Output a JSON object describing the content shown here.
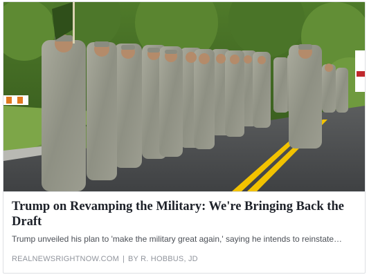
{
  "link_preview": {
    "headline": "Trump on Revamping the Military: We're Bringing Back the Draft",
    "description": "Trump unveiled his plan to 'make the military great again,' saying he intends to reinstate…",
    "source": "REALNEWSRIGHTNOW.COM",
    "separator": "|",
    "byline": "BY R. HOBBUS, JD"
  },
  "colors": {
    "headline": "#1d2129",
    "description": "#4b4f56",
    "meta": "#90949c",
    "border": "#dddfe2",
    "road_marking": "#f2c200"
  }
}
